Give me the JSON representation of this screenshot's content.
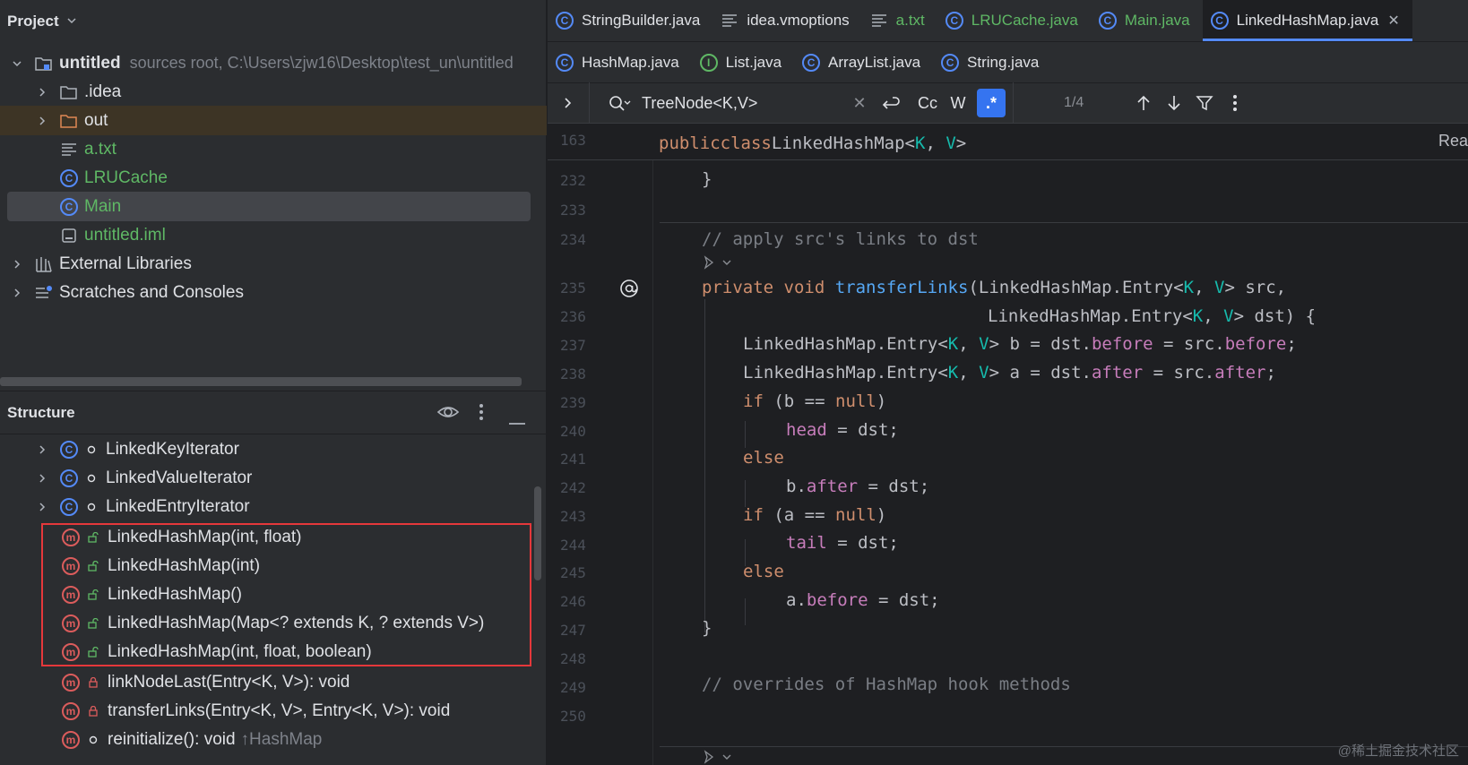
{
  "project": {
    "header": "Project",
    "root": {
      "name": "untitled",
      "meta": "sources root,  C:\\Users\\zjw16\\Desktop\\test_un\\untitled"
    },
    "items": [
      {
        "label": ".idea"
      },
      {
        "label": "out"
      },
      {
        "label": "a.txt"
      },
      {
        "label": "LRUCache"
      },
      {
        "label": "Main"
      },
      {
        "label": "untitled.iml"
      },
      {
        "label": "External Libraries"
      },
      {
        "label": "Scratches and Consoles"
      }
    ]
  },
  "structure": {
    "header": "Structure",
    "items": [
      {
        "label": "LinkedKeyIterator"
      },
      {
        "label": "LinkedValueIterator"
      },
      {
        "label": "LinkedEntryIterator"
      },
      {
        "label": "LinkedHashMap(int, float)"
      },
      {
        "label": "LinkedHashMap(int)"
      },
      {
        "label": "LinkedHashMap()"
      },
      {
        "label": "LinkedHashMap(Map<? extends K, ? extends V>)"
      },
      {
        "label": "LinkedHashMap(int, float, boolean)"
      },
      {
        "label": "linkNodeLast(Entry<K, V>): void"
      },
      {
        "label": "transferLinks(Entry<K, V>, Entry<K, V>): void"
      },
      {
        "label": "reinitialize(): void",
        "suffix": "↑HashMap"
      }
    ]
  },
  "tabs_row1": [
    {
      "label": "StringBuilder.java"
    },
    {
      "label": "idea.vmoptions"
    },
    {
      "label": "a.txt"
    },
    {
      "label": "LRUCache.java"
    },
    {
      "label": "Main.java"
    },
    {
      "label": "LinkedHashMap.java"
    }
  ],
  "tabs_row2": [
    {
      "label": "HashMap.java"
    },
    {
      "label": "List.java"
    },
    {
      "label": "ArrayList.java"
    },
    {
      "label": "String.java"
    }
  ],
  "find": {
    "query": "TreeNode<K,V>",
    "cc": "Cc",
    "w": "W",
    "regex": ".*",
    "count": "1/4"
  },
  "editor": {
    "sticky_line": "163",
    "reader_mode": "Rea",
    "line_numbers": [
      "232",
      "233",
      "234",
      "235",
      "236",
      "237",
      "238",
      "239",
      "240",
      "241",
      "242",
      "243",
      "244",
      "245",
      "246",
      "247",
      "248",
      "249",
      "250"
    ],
    "sticky": {
      "kw1": "public",
      "kw2": "class",
      "name": "LinkedHashMap<",
      "k": "K",
      "comma": ", ",
      "v": "V",
      "close": ">"
    },
    "code": {
      "l232": "}",
      "l234": "// apply src's links to dst",
      "l235_kw": "private void ",
      "l235_fn": "transferLinks",
      "l235_rest1": "(LinkedHashMap.Entry<",
      "l235_k": "K",
      "l235_c": ", ",
      "l235_v": "V",
      "l235_rest2": "> src,",
      "l236_a": "LinkedHashMap.Entry<",
      "l236_k": "K",
      "l236_c": ", ",
      "l236_v": "V",
      "l236_b": "> dst) {",
      "l237_a": "LinkedHashMap.Entry<",
      "l237_k": "K",
      "l237_c": ", ",
      "l237_v": "V",
      "l237_b": "> b = dst.",
      "l237_f1": "before",
      "l237_eq": " = src.",
      "l237_f2": "before",
      "l237_end": ";",
      "l238_a": "LinkedHashMap.Entry<",
      "l238_k": "K",
      "l238_c": ", ",
      "l238_v": "V",
      "l238_b": "> a = dst.",
      "l238_f1": "after",
      "l238_eq": " = src.",
      "l238_f2": "after",
      "l238_end": ";",
      "l239_kw": "if",
      "l239_a": " (b ",
      "l239_op": "==",
      "l239_sp": " ",
      "l239_null": "null",
      "l239_b": ")",
      "l240_f": "head",
      "l240_rest": " = dst;",
      "l241_kw": "else",
      "l242_a": "b.",
      "l242_f": "after",
      "l242_rest": " = dst;",
      "l243_kw": "if",
      "l243_a": " (a ",
      "l243_op": "==",
      "l243_sp": " ",
      "l243_null": "null",
      "l243_b": ")",
      "l244_f": "tail",
      "l244_rest": " = dst;",
      "l245_kw": "else",
      "l246_a": "a.",
      "l246_f": "before",
      "l246_rest": " = dst;",
      "l247": "}",
      "l249": "// overrides of HashMap hook methods"
    }
  },
  "watermark": "@稀土掘金技术社区",
  "colors": {
    "accent": "#548af7",
    "highlight_box": "#e5383b",
    "method": "#db5c5c",
    "green_file": "#5fb865"
  }
}
